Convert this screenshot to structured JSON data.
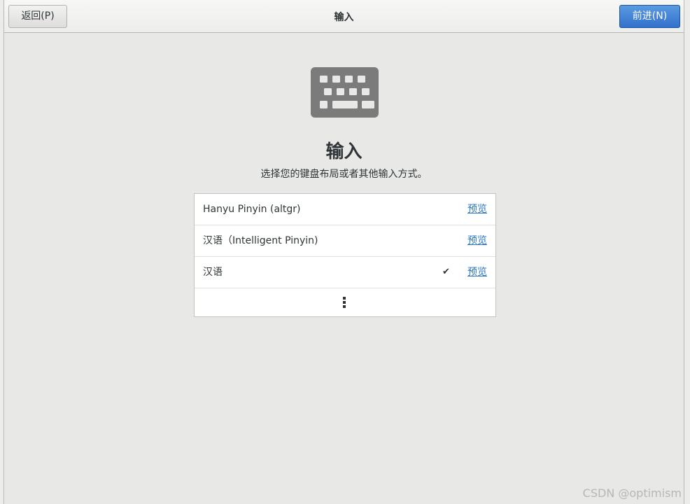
{
  "header": {
    "back_label": "返回(P)",
    "title": "输入",
    "next_label": "前进(N)"
  },
  "main": {
    "icon": "keyboard-icon",
    "title": "输入",
    "subtitle": "选择您的键盘布局或者其他输入方式。"
  },
  "input_sources": [
    {
      "label": "Hanyu Pinyin (altgr)",
      "selected": false,
      "preview_label": "预览"
    },
    {
      "label": "汉语（Intelligent Pinyin)",
      "selected": false,
      "preview_label": "预览"
    },
    {
      "label": "汉语",
      "selected": true,
      "check_glyph": "✔",
      "preview_label": "预览"
    }
  ],
  "more_icon": "more-vertical-icon",
  "watermark": "CSDN @optimism",
  "colors": {
    "accent": "#3370cb",
    "link": "#2a76c6",
    "background": "#e8e8e7",
    "text": "#2e3436"
  }
}
